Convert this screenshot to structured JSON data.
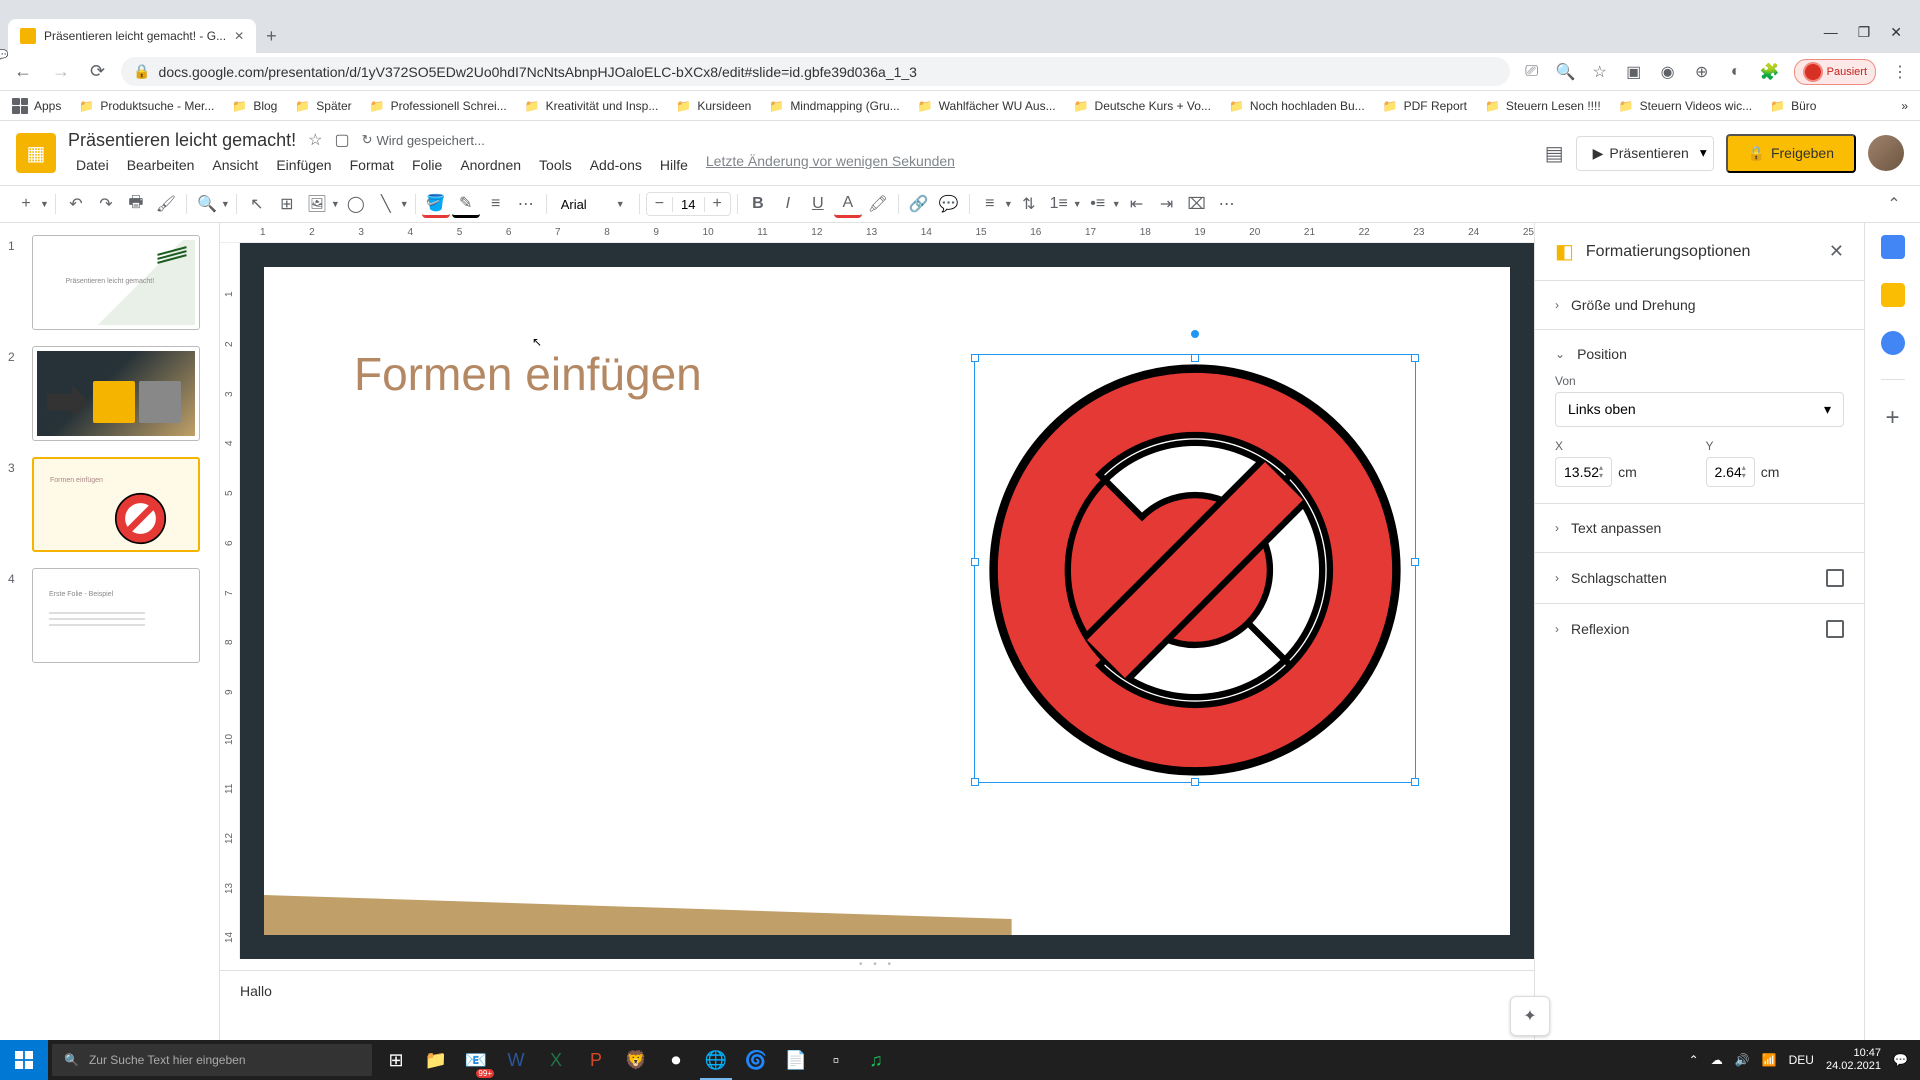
{
  "browser": {
    "tab_title": "Präsentieren leicht gemacht! - G...",
    "url": "docs.google.com/presentation/d/1yV372SO5EDw2Uo0hdI7NcNtsAbnpHJOaloELC-bXCx8/edit#slide=id.gbfe39d036a_1_3",
    "pause_label": "Pausiert"
  },
  "bookmarks": {
    "apps": "Apps",
    "items": [
      "Produktsuche - Mer...",
      "Blog",
      "Später",
      "Professionell Schrei...",
      "Kreativität und Insp...",
      "Kursideen",
      "Mindmapping  (Gru...",
      "Wahlfächer WU Aus...",
      "Deutsche Kurs + Vo...",
      "Noch hochladen Bu...",
      "PDF Report",
      "Steuern Lesen !!!!",
      "Steuern Videos wic...",
      "Büro"
    ]
  },
  "doc": {
    "title": "Präsentieren leicht gemacht!",
    "saving": "Wird gespeichert...",
    "last_change": "Letzte Änderung vor wenigen Sekunden"
  },
  "menu": {
    "items": [
      "Datei",
      "Bearbeiten",
      "Ansicht",
      "Einfügen",
      "Format",
      "Folie",
      "Anordnen",
      "Tools",
      "Add-ons",
      "Hilfe"
    ]
  },
  "header_buttons": {
    "present": "Präsentieren",
    "share": "Freigeben"
  },
  "toolbar": {
    "font": "Arial",
    "font_size": "14"
  },
  "slides": {
    "s1_text": "Präsentieren leicht gemacht!",
    "s3_text": "Formen einfügen",
    "s4_text": "Erste Folie - Beispiel"
  },
  "canvas": {
    "title": "Formen einfügen"
  },
  "notes": {
    "text": "Hallo"
  },
  "ruler_h": [
    "1",
    "2",
    "3",
    "4",
    "5",
    "6",
    "7",
    "8",
    "9",
    "10",
    "11",
    "12",
    "13",
    "14",
    "15",
    "16",
    "17",
    "18",
    "19",
    "20",
    "21",
    "22",
    "23",
    "24",
    "25"
  ],
  "ruler_v": [
    "1",
    "2",
    "3",
    "4",
    "5",
    "6",
    "7",
    "8",
    "9",
    "10",
    "11",
    "12",
    "13",
    "14"
  ],
  "format_panel": {
    "title": "Formatierungsoptionen",
    "size_rotation": "Größe und Drehung",
    "position": "Position",
    "from_label": "Von",
    "from_value": "Links oben",
    "x_label": "X",
    "y_label": "Y",
    "x_value": "13.52",
    "y_value": "2.64",
    "unit": "cm",
    "text_fit": "Text anpassen",
    "drop_shadow": "Schlagschatten",
    "reflection": "Reflexion"
  },
  "taskbar": {
    "search_placeholder": "Zur Suche Text hier eingeben",
    "time": "10:47",
    "date": "24.02.2021",
    "lang": "DEU",
    "mail_count": "99+"
  }
}
